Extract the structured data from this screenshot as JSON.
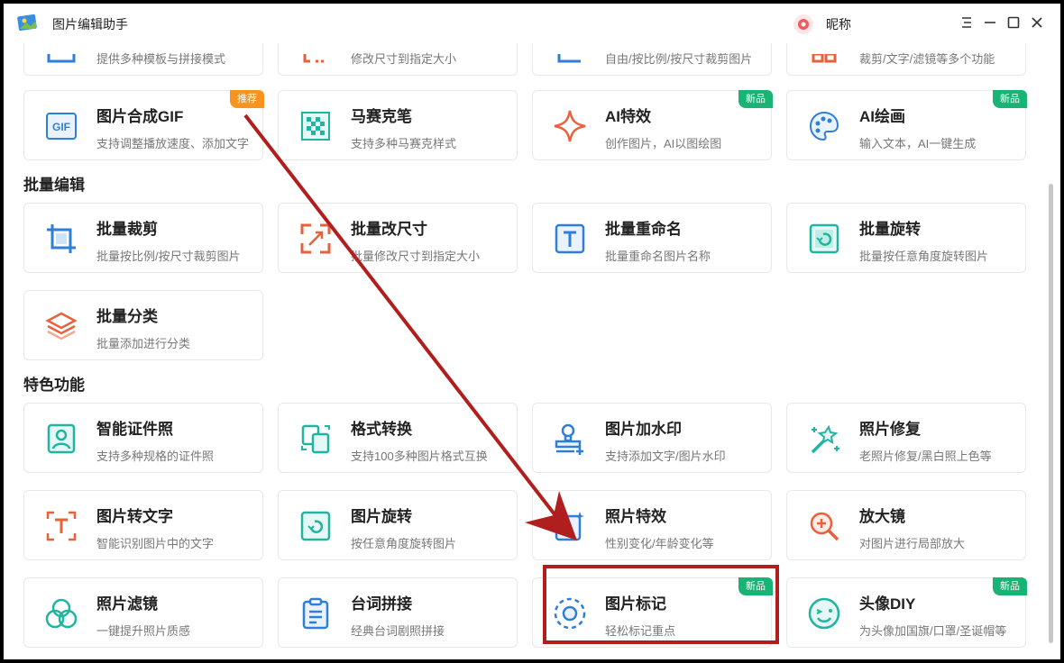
{
  "app": {
    "title": "图片编辑助手",
    "user_name": "昵称"
  },
  "sections": {
    "batch": "批量编辑",
    "feature": "特色功能"
  },
  "top_row": [
    {
      "desc": "提供多种模板与拼接模式"
    },
    {
      "desc": "修改尺寸到指定大小"
    },
    {
      "desc": "自由/按比例/按尺寸裁剪图片"
    },
    {
      "desc": "裁剪/文字/滤镜等多个功能"
    }
  ],
  "row1": [
    {
      "title": "图片合成GIF",
      "desc": "支持调整播放速度、添加文字",
      "badge": "推荐",
      "icon": "gif-icon"
    },
    {
      "title": "马赛克笔",
      "desc": "支持多种马赛克样式",
      "icon": "mosaic-icon"
    },
    {
      "title": "AI特效",
      "desc": "创作图片，AI以图绘图",
      "badge": "新品",
      "icon": "sparkle-icon"
    },
    {
      "title": "AI绘画",
      "desc": "输入文本，AI一键生成",
      "badge": "新品",
      "icon": "palette-icon"
    }
  ],
  "batch": [
    {
      "title": "批量裁剪",
      "desc": "批量按比例/按尺寸裁剪图片",
      "icon": "crop-icon"
    },
    {
      "title": "批量改尺寸",
      "desc": "批量修改尺寸到指定大小",
      "icon": "resize-icon"
    },
    {
      "title": "批量重命名",
      "desc": "批量重命名图片名称",
      "icon": "text-t-icon"
    },
    {
      "title": "批量旋转",
      "desc": "批量按任意角度旋转图片",
      "icon": "rotate-icon"
    },
    {
      "title": "批量分类",
      "desc": "批量添加进行分类",
      "icon": "layers-icon"
    }
  ],
  "feature": [
    {
      "title": "智能证件照",
      "desc": "支持多种规格的证件照",
      "icon": "id-photo-icon"
    },
    {
      "title": "格式转换",
      "desc": "支持100多种图片格式互换",
      "icon": "convert-icon"
    },
    {
      "title": "图片加水印",
      "desc": "支持添加文字/图片水印",
      "icon": "stamp-icon"
    },
    {
      "title": "照片修复",
      "desc": "老照片修复/黑白照上色等",
      "icon": "magic-wand-icon"
    },
    {
      "title": "图片转文字",
      "desc": "智能识别图片中的文字",
      "icon": "ocr-icon"
    },
    {
      "title": "图片旋转",
      "desc": "按任意角度旋转图片",
      "icon": "rotate-image-icon"
    },
    {
      "title": "照片特效",
      "desc": "性别变化/年龄变化等",
      "icon": "photo-effect-icon"
    },
    {
      "title": "放大镜",
      "desc": "对图片进行局部放大",
      "icon": "magnifier-icon"
    },
    {
      "title": "照片滤镜",
      "desc": "一键提升照片质感",
      "icon": "filter-icon"
    },
    {
      "title": "台词拼接",
      "desc": "经典台词剧照拼接",
      "icon": "clipboard-icon"
    },
    {
      "title": "图片标记",
      "desc": "轻松标记重点",
      "badge": "新品",
      "icon": "mark-circle-icon"
    },
    {
      "title": "头像DIY",
      "desc": "为头像加国旗/口罩/圣诞帽等",
      "badge": "新品",
      "icon": "smiley-icon"
    }
  ],
  "colors": {
    "blue": "#2f7fd8",
    "orange": "#e8613a",
    "teal": "#1fb5a0",
    "green_badge": "#19b374",
    "orange_badge": "#f7931e",
    "annotation_red": "#b01e1e"
  }
}
